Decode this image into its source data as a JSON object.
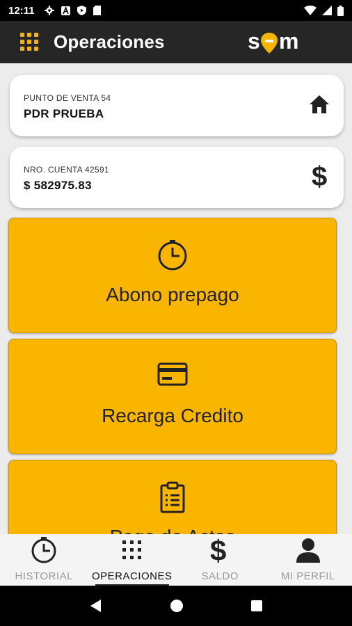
{
  "status_bar": {
    "time": "12:11",
    "left_icons": [
      "settings-icon",
      "a-icon",
      "shield-icon",
      "sd-card-icon"
    ],
    "right_icons": [
      "wifi-icon",
      "signal-icon",
      "battery-icon"
    ]
  },
  "app_bar": {
    "title": "Operaciones",
    "brand": "sem",
    "accent": "#f5b400",
    "background": "#262626"
  },
  "cards": [
    {
      "label": "PUNTO DE VENTA 54",
      "value": "PDR PRUEBA",
      "icon": "home-icon"
    },
    {
      "label": "NRO. CUENTA 42591",
      "value": "$ 582975.83",
      "icon": "dollar-icon"
    }
  ],
  "operations": [
    {
      "label": "Abono prepago",
      "icon": "clock-icon"
    },
    {
      "label": "Recarga Credito",
      "icon": "credit-card-icon"
    },
    {
      "label": "Pago de Actas",
      "icon": "clipboard-icon"
    }
  ],
  "tile_color": "#f9b500",
  "bottom_nav": [
    {
      "label": "HISTORIAL",
      "icon": "clock-icon",
      "active": false
    },
    {
      "label": "OPERACIONES",
      "icon": "grid-icon",
      "active": true
    },
    {
      "label": "SALDO",
      "icon": "dollar-icon",
      "active": false
    },
    {
      "label": "MI PERFIL",
      "icon": "person-icon",
      "active": false
    }
  ],
  "system_nav": [
    "back-icon",
    "home-circle-icon",
    "recents-icon"
  ]
}
